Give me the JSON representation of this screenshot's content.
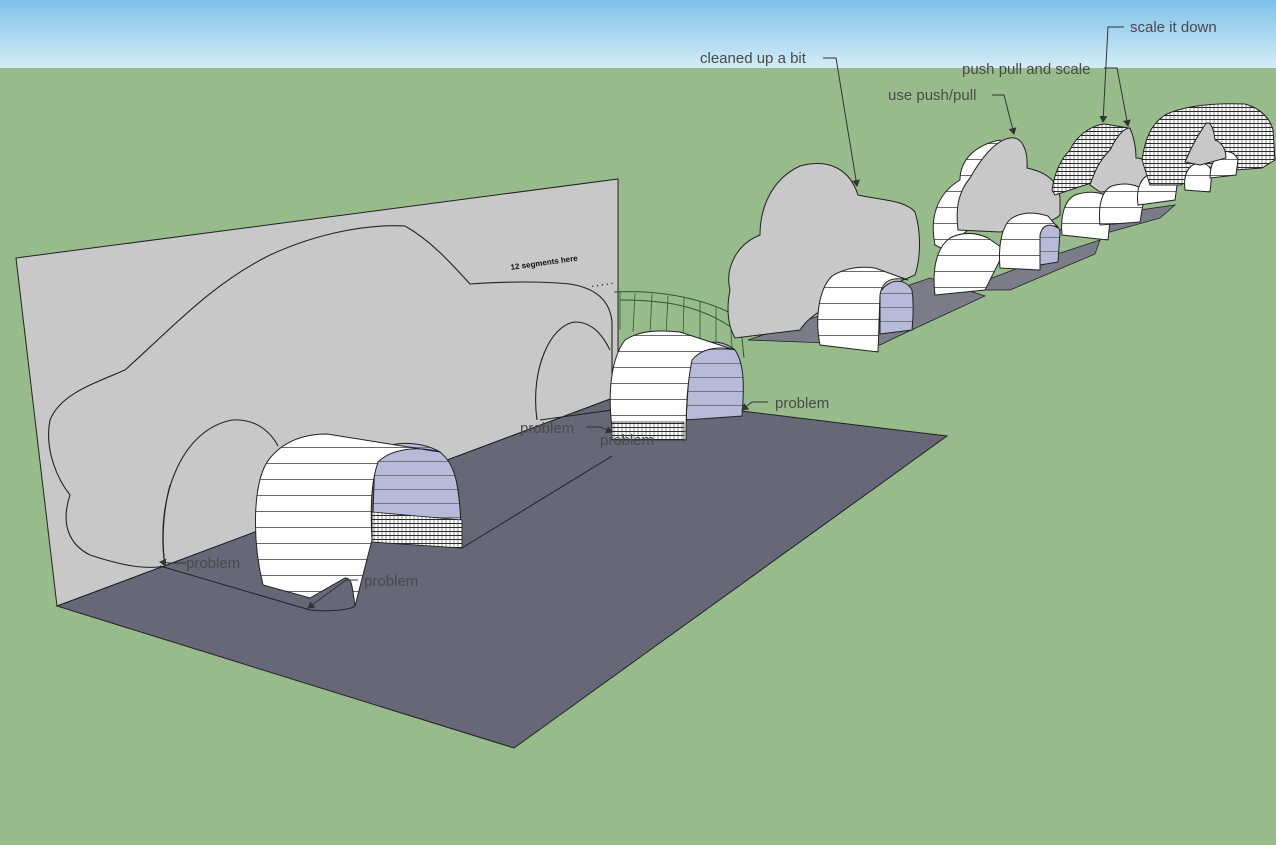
{
  "scene": {
    "sky_color": "#b5ddf2",
    "ground_color": "#98bb8c",
    "panel_color": "#c8c8c8",
    "floor_color": "#666878",
    "arch_face_color": "#ffffff",
    "arch_inner_color": "#b7bad8"
  },
  "annotations": {
    "cleaned_up": "cleaned up a bit",
    "push_pull": "use push/pull",
    "push_pull_scale": "push pull and scale",
    "scale_down": "scale it down",
    "problem_1": "problem",
    "problem_2": "problem",
    "problem_3": "problem",
    "problem_4": "problem",
    "problem_5": "problem",
    "segments_note": "12 segments here"
  }
}
